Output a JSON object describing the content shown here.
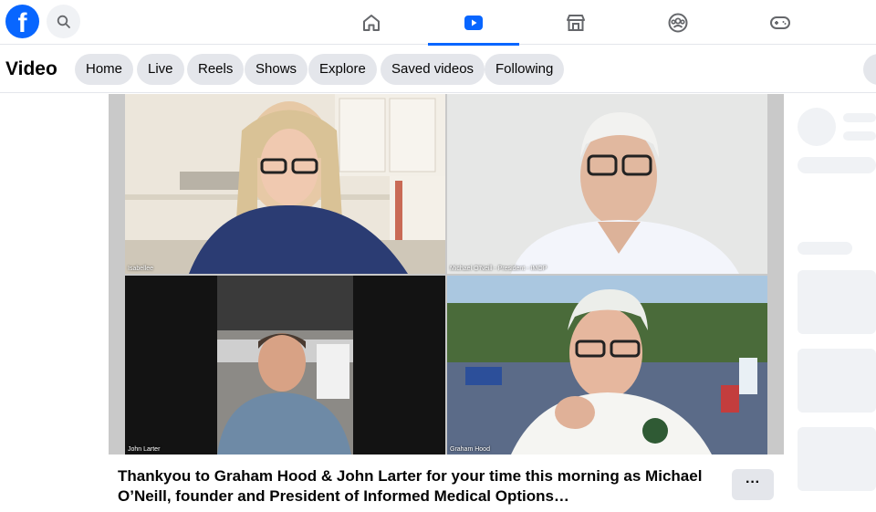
{
  "brand": {
    "logo_letter": "f",
    "color": "#0866ff"
  },
  "nav": {
    "tabs": [
      {
        "name": "home",
        "icon": "home-icon",
        "active": false
      },
      {
        "name": "video",
        "icon": "video-icon",
        "active": true
      },
      {
        "name": "marketplace",
        "icon": "marketplace-icon",
        "active": false
      },
      {
        "name": "groups",
        "icon": "groups-icon",
        "active": false
      },
      {
        "name": "gaming",
        "icon": "gaming-icon",
        "active": false
      }
    ]
  },
  "subnav": {
    "title": "Video",
    "pills": [
      "Home",
      "Live",
      "Reels",
      "Shows",
      "Explore",
      "Saved videos",
      "Following"
    ]
  },
  "video": {
    "participants": [
      {
        "label": "Isabellee"
      },
      {
        "label": "Michael O'Neill - President - IMOP"
      },
      {
        "label": "John Larter"
      },
      {
        "label": "Graham Hood"
      }
    ],
    "caption": "Thankyou to Graham Hood & John Larter for your time this morning as Michael O’Neill, founder and President of Informed Medical Options…",
    "more_label": "···"
  }
}
